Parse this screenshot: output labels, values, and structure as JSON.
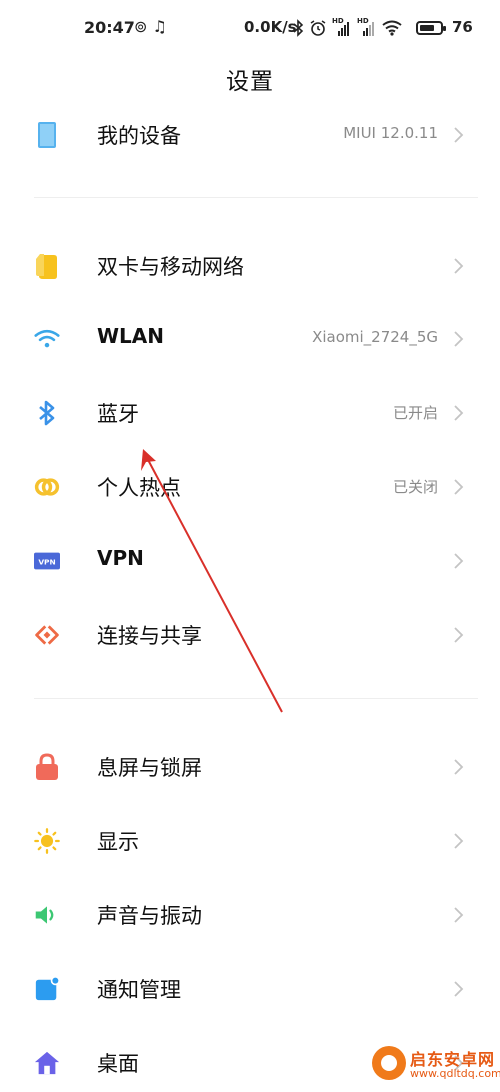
{
  "status_bar": {
    "time": "20:47",
    "left_icons": "⊚ ♫",
    "net_speed": "0.0K/s",
    "hd_label": "HD",
    "battery_text": "76",
    "battery_level": 0.76
  },
  "page": {
    "title": "设置"
  },
  "rows": [
    {
      "id": "my-device",
      "label": "我的设备",
      "value": "MIUI 12.0.11",
      "icon": "tablet-icon",
      "color": "#56b2ee"
    },
    {
      "id": "dual-sim",
      "label": "双卡与移动网络",
      "value": "",
      "icon": "sim-icon",
      "color": "#f7c21e"
    },
    {
      "id": "wlan",
      "label": "WLAN",
      "value": "Xiaomi_2724_5G",
      "icon": "wifi-icon",
      "color": "#3aa7e8"
    },
    {
      "id": "bluetooth",
      "label": "蓝牙",
      "value": "已开启",
      "icon": "bluetooth-icon",
      "color": "#3a92e8"
    },
    {
      "id": "hotspot",
      "label": "个人热点",
      "value": "已关闭",
      "icon": "hotspot-icon",
      "color": "#f5c12e"
    },
    {
      "id": "vpn",
      "label": "VPN",
      "value": "",
      "icon": "vpn-icon",
      "color": "#4a68d8",
      "badge": "VPN"
    },
    {
      "id": "connection-share",
      "label": "连接与共享",
      "value": "",
      "icon": "share-icon",
      "color": "#ee6a45"
    },
    {
      "id": "lock-screen",
      "label": "息屏与锁屏",
      "value": "",
      "icon": "lock-icon",
      "color": "#f06a5a"
    },
    {
      "id": "display",
      "label": "显示",
      "value": "",
      "icon": "sun-icon",
      "color": "#f7c11e"
    },
    {
      "id": "sound",
      "label": "声音与振动",
      "value": "",
      "icon": "speaker-icon",
      "color": "#3cc773"
    },
    {
      "id": "notifications",
      "label": "通知管理",
      "value": "",
      "icon": "notification-icon",
      "color": "#2c9cf0"
    },
    {
      "id": "desktop",
      "label": "桌面",
      "value": "",
      "icon": "home-icon",
      "color": "#6a62e8"
    }
  ],
  "watermark": {
    "title": "启东安卓网",
    "url": "www.qdltdq.com"
  }
}
